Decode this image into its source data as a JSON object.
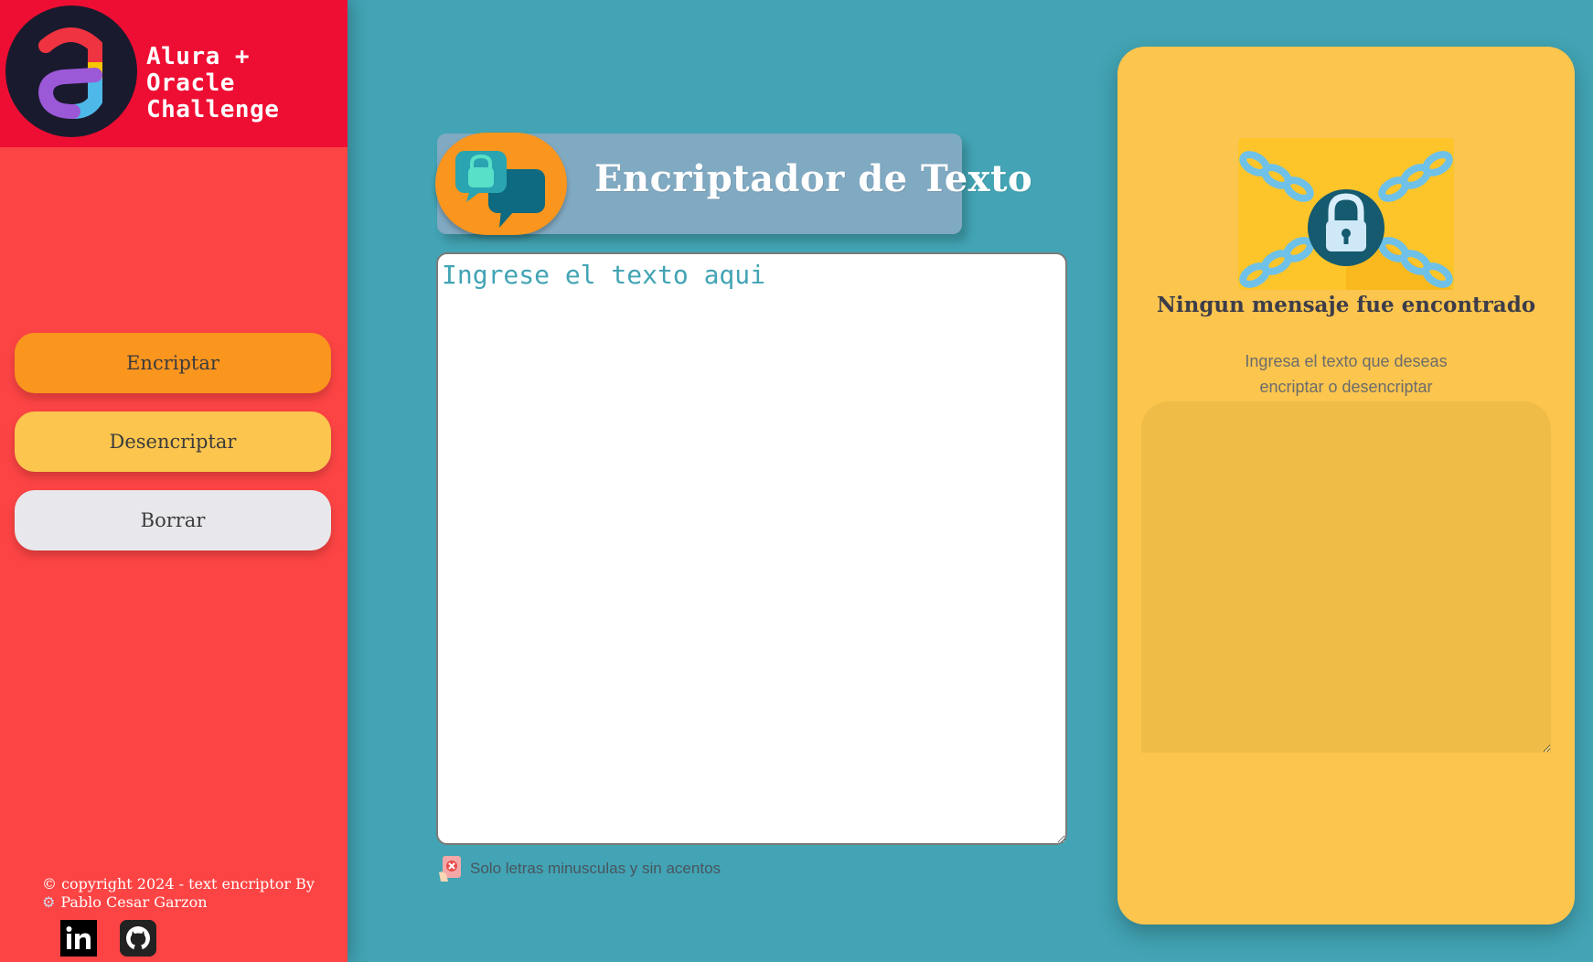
{
  "brand": {
    "line1": "Alura + Oracle",
    "line2": "Challenge"
  },
  "title": "Encriptador de Texto",
  "buttons": {
    "encrypt": "Encriptar",
    "decrypt": "Desencriptar",
    "clear": "Borrar"
  },
  "input": {
    "placeholder": "Ingrese el texto aqui",
    "value": ""
  },
  "hint": "Solo letras minusculas y sin acentos",
  "result": {
    "empty_title": "Ningun mensaje fue encontrado",
    "empty_description": "Ingresa el texto que deseas encriptar o desencriptar",
    "output_value": ""
  },
  "footer": {
    "copyright": "© copyright 2024 - text encriptor By",
    "author": "Pablo Cesar Garzon"
  },
  "icons": {
    "logo": "alura-logo-icon",
    "title": "chat-lock-icon",
    "hint": "warning-hand-icon",
    "result": "locked-folder-icon",
    "linkedin": "linkedin-icon",
    "github": "github-icon",
    "gear": "gear-icon"
  },
  "colors": {
    "background": "#42a4b4",
    "sidebar": "#fd4444",
    "sidebar_header": "#ef0e33",
    "encrypt_button": "#fa951e",
    "decrypt_button": "#fbc54e",
    "clear_button": "#e8e8ec",
    "title_banner": "#80a9c2",
    "result_panel": "#fbc54e"
  }
}
